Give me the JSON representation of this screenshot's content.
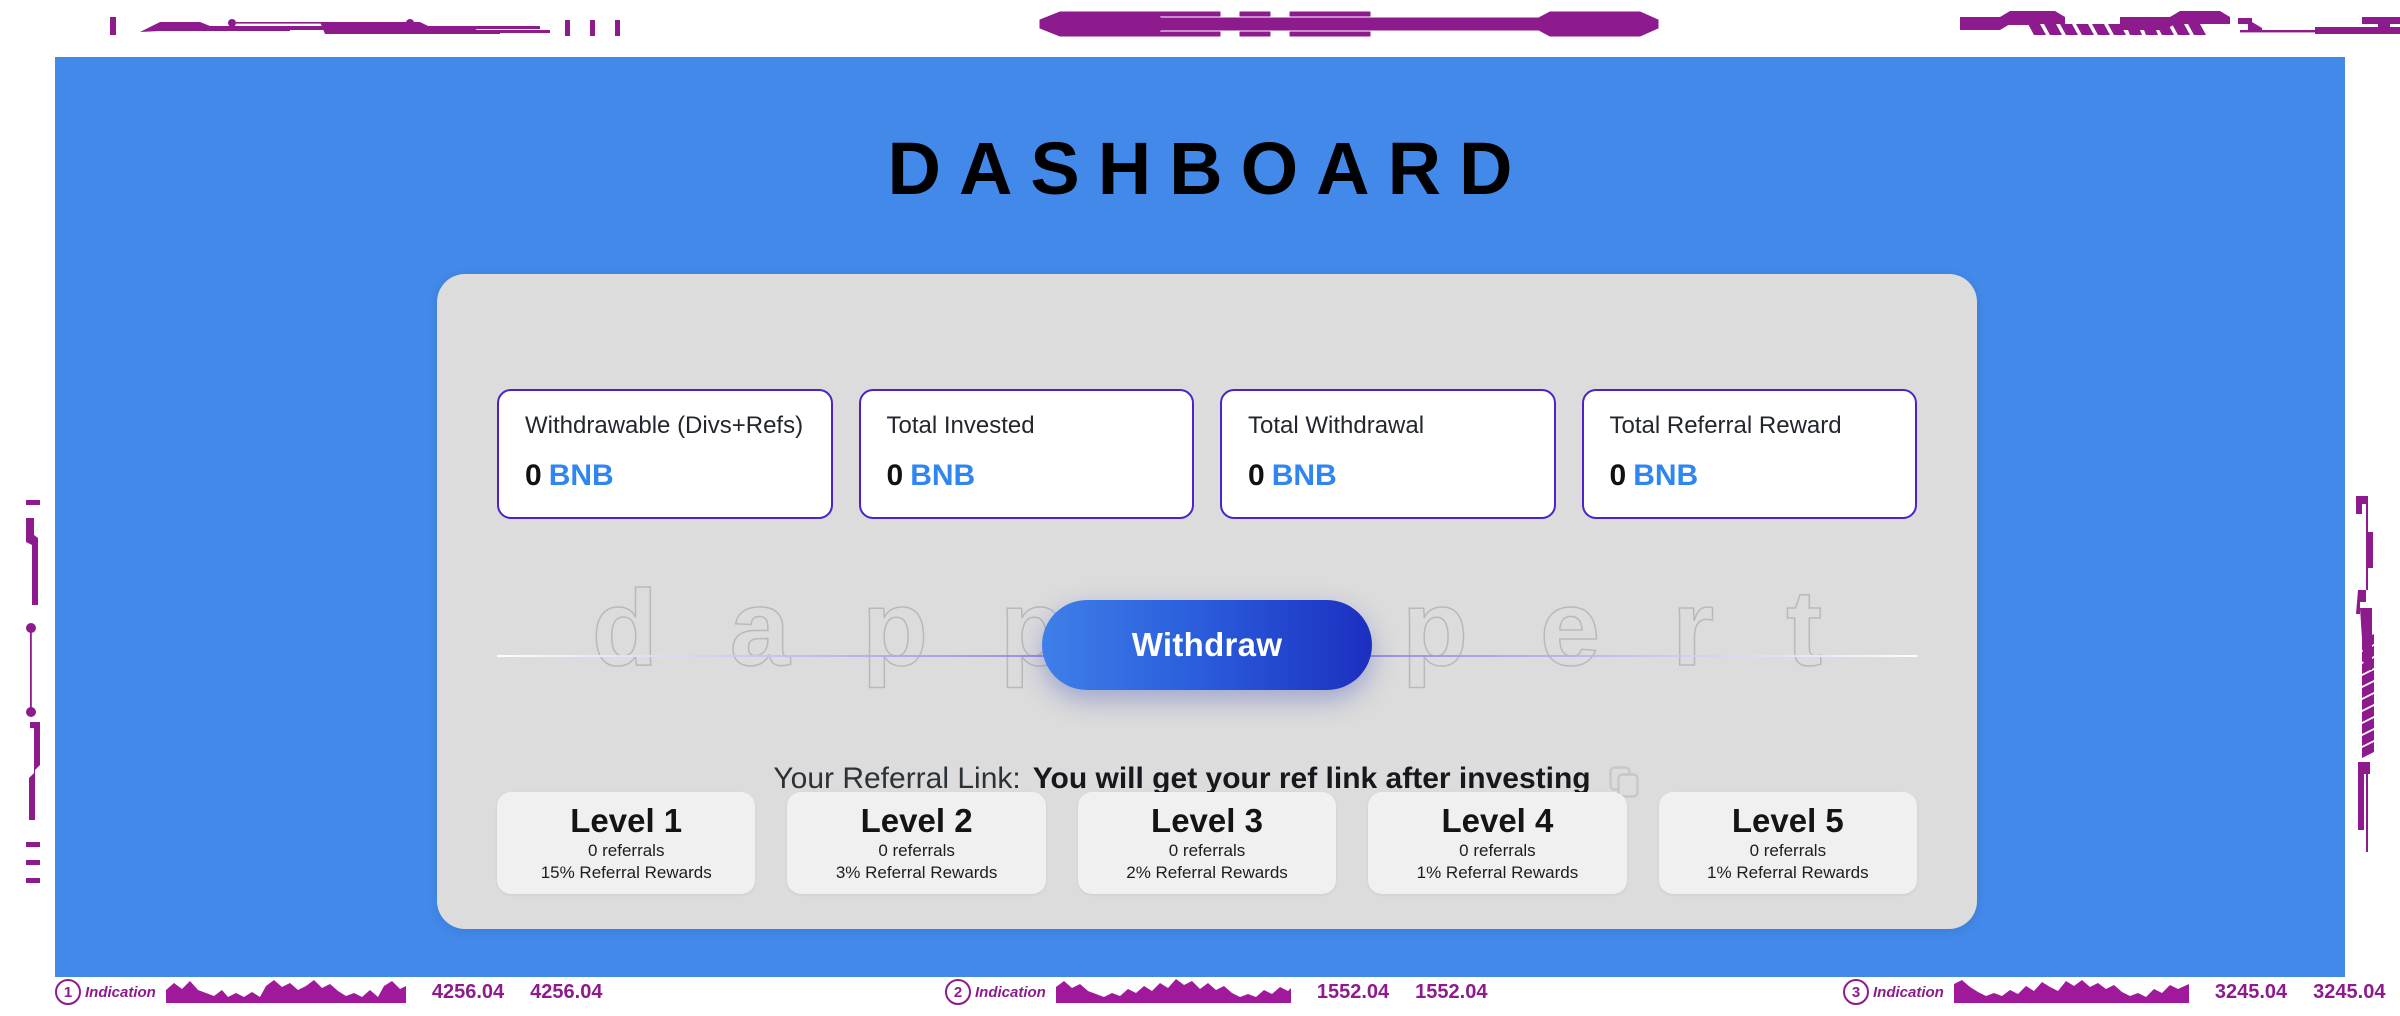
{
  "colors": {
    "page_blue": "#4389ea",
    "panel_grey": "#dcdcdc",
    "card_border_purple": "#4b23c9",
    "unit_blue": "#2f86f0",
    "withdraw_from": "#3f7fe8",
    "withdraw_to": "#1c2fc0",
    "deco_purple": "#8e1b8e",
    "watermark_stroke": "#b9b9bd"
  },
  "header": {
    "title": "DASHBOARD"
  },
  "panel": {
    "watermark": "dappexpert"
  },
  "stats": [
    {
      "label": "Withdrawable (Divs+Refs)",
      "value": "0",
      "unit": "BNB"
    },
    {
      "label": "Total Invested",
      "value": "0",
      "unit": "BNB"
    },
    {
      "label": "Total Withdrawal",
      "value": "0",
      "unit": "BNB"
    },
    {
      "label": "Total Referral Reward",
      "value": "0",
      "unit": "BNB"
    }
  ],
  "withdraw": {
    "label": "Withdraw"
  },
  "referral": {
    "label": "Your Referral Link:",
    "value": "You will get your ref link after investing",
    "copy_icon": "copy-icon"
  },
  "levels": [
    {
      "title": "Level 1",
      "referrals": "0 referrals",
      "rewards": "15% Referral Rewards"
    },
    {
      "title": "Level 2",
      "referrals": "0 referrals",
      "rewards": "3% Referral Rewards"
    },
    {
      "title": "Level 3",
      "referrals": "0 referrals",
      "rewards": "2% Referral Rewards"
    },
    {
      "title": "Level 4",
      "referrals": "0 referrals",
      "rewards": "1% Referral Rewards"
    },
    {
      "title": "Level 5",
      "referrals": "0 referrals",
      "rewards": "1% Referral Rewards"
    }
  ],
  "indications": [
    {
      "badge": "1",
      "label": "Indication",
      "value_a": "4256.04",
      "value_b": "4256.04"
    },
    {
      "badge": "2",
      "label": "Indication",
      "value_a": "1552.04",
      "value_b": "1552.04"
    },
    {
      "badge": "3",
      "label": "Indication",
      "value_a": "3245.04",
      "value_b": "3245.04"
    }
  ]
}
